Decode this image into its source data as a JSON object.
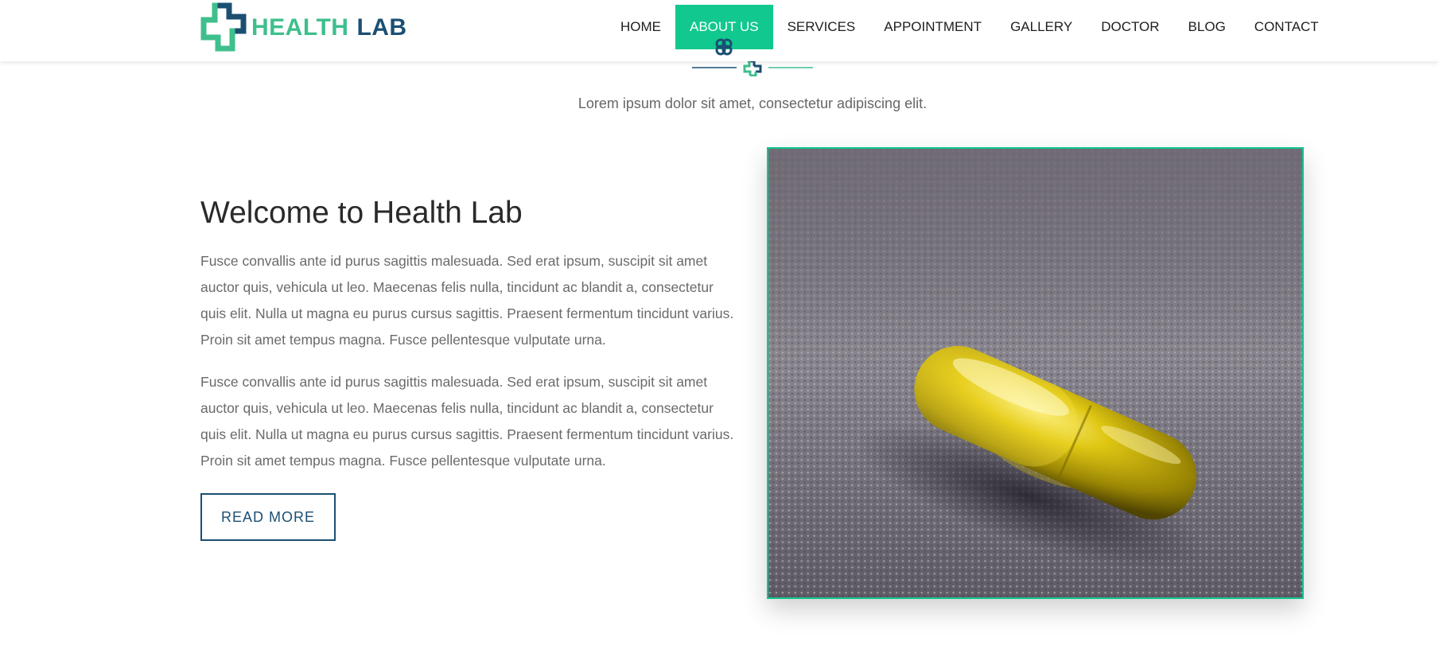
{
  "brand": {
    "word1": "HEALTH",
    "word2": "LAB",
    "logo_icon": "cross-logo-icon",
    "colors": {
      "green": "#3ebf8c",
      "navy": "#1b4f72",
      "accent": "#11c88f"
    }
  },
  "nav": {
    "items": [
      {
        "label": "HOME",
        "active": false
      },
      {
        "label": "ABOUT US",
        "active": true
      },
      {
        "label": "SERVICES",
        "active": false
      },
      {
        "label": "APPOINTMENT",
        "active": false
      },
      {
        "label": "GALLERY",
        "active": false
      },
      {
        "label": "DOCTOR",
        "active": false
      },
      {
        "label": "BLOG",
        "active": false
      },
      {
        "label": "CONTACT",
        "active": false
      }
    ]
  },
  "section": {
    "subtitle": "Lorem ipsum dolor sit amet, consectetur adipiscing elit."
  },
  "about": {
    "title": "Welcome to Health Lab",
    "paragraph1": "Fusce convallis ante id purus sagittis malesuada. Sed erat ipsum, suscipit sit amet auctor quis, vehicula ut leo. Maecenas felis nulla, tincidunt ac blandit a, consectetur quis elit. Nulla ut magna eu purus cursus sagittis. Praesent fermentum tincidunt varius. Proin sit amet tempus magna. Fusce pellentesque vulputate urna.",
    "paragraph2": "Fusce convallis ante id purus sagittis malesuada. Sed erat ipsum, suscipit sit amet auctor quis, vehicula ut leo. Maecenas felis nulla, tincidunt ac blandit a, consectetur quis elit. Nulla ut magna eu purus cursus sagittis. Praesent fermentum tincidunt varius. Proin sit amet tempus magna. Fusce pellentesque vulputate urna.",
    "button_label": "READ MORE"
  }
}
